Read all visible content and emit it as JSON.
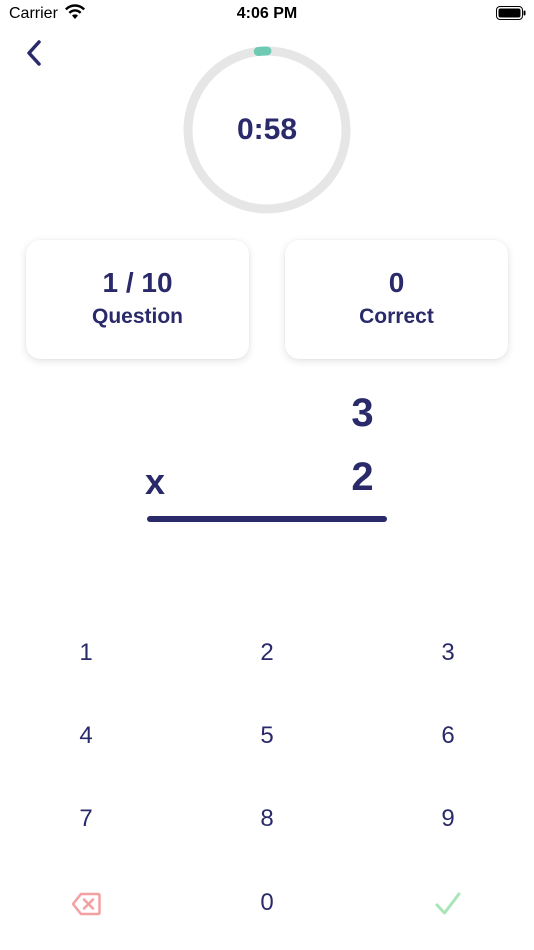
{
  "status_bar": {
    "carrier": "Carrier",
    "time": "4:06 PM"
  },
  "timer": {
    "display": "0:58",
    "progress": 0.033,
    "track_color": "#e6e6e6",
    "progress_color": "#6fcab4"
  },
  "stats": {
    "question": {
      "value": "1 / 10",
      "label": "Question"
    },
    "correct": {
      "value": "0",
      "label": "Correct"
    }
  },
  "problem": {
    "top": "3",
    "bottom": "2",
    "operator": "x"
  },
  "keypad": {
    "keys": [
      "1",
      "2",
      "3",
      "4",
      "5",
      "6",
      "7",
      "8",
      "9"
    ],
    "zero": "0",
    "delete_icon": "backspace-icon",
    "submit_icon": "checkmark-icon",
    "delete_color": "#f4a0a0",
    "submit_color": "#a8e6b8"
  },
  "colors": {
    "primary": "#2a2a6b"
  }
}
